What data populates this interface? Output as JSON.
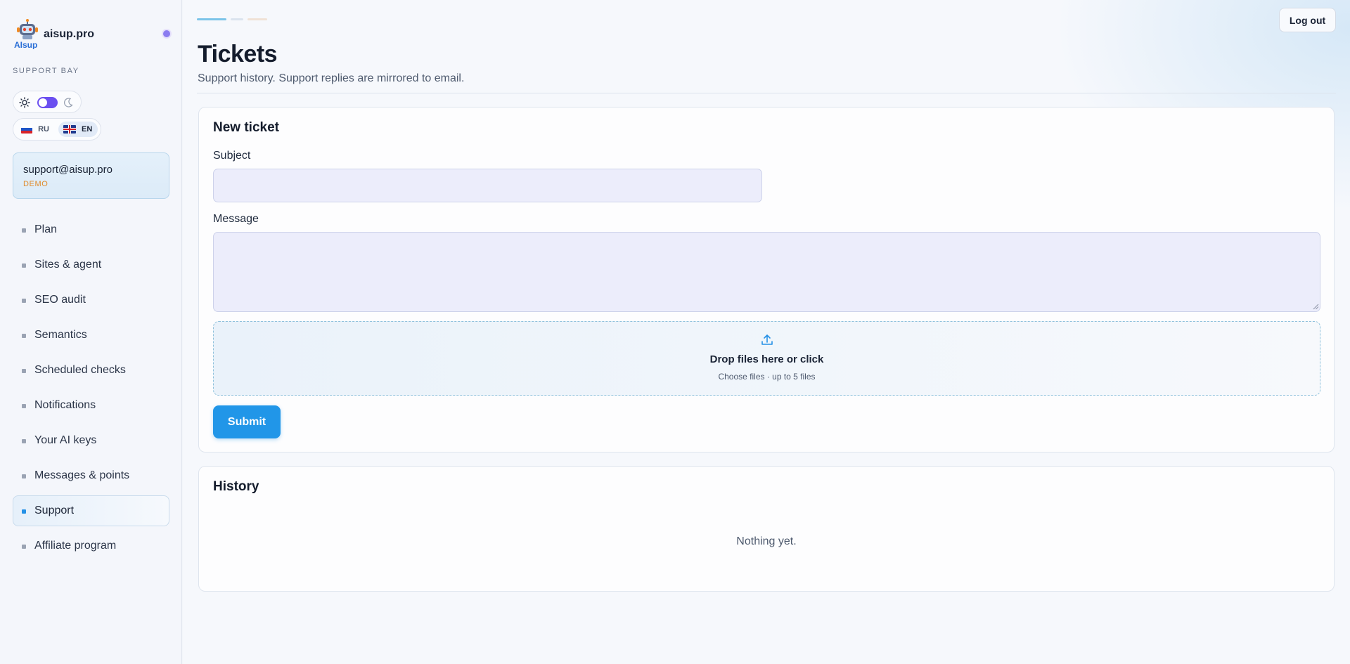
{
  "app": {
    "brand_name": "aisup.pro",
    "logo_text": "AIsup",
    "section_label": "SUPPORT BAY",
    "accent_color": "#2196e8",
    "theme_toggle_color": "#6b4ff0"
  },
  "language": {
    "options": [
      "RU",
      "EN"
    ],
    "selected": "EN"
  },
  "account": {
    "email": "support@aisup.pro",
    "badge": "DEMO"
  },
  "nav": {
    "items": [
      {
        "label": "Plan"
      },
      {
        "label": "Sites & agent"
      },
      {
        "label": "SEO audit"
      },
      {
        "label": "Semantics"
      },
      {
        "label": "Scheduled checks"
      },
      {
        "label": "Notifications"
      },
      {
        "label": "Your AI keys"
      },
      {
        "label": "Messages & points"
      },
      {
        "label": "Support",
        "active": true
      },
      {
        "label": "Affiliate program"
      }
    ]
  },
  "header": {
    "logout_label": "Log out",
    "title": "Tickets",
    "subtitle": "Support history. Support replies are mirrored to email."
  },
  "new_ticket": {
    "title": "New ticket",
    "subject_label": "Subject",
    "subject_value": "",
    "message_label": "Message",
    "message_value": "",
    "drop_title": "Drop files here or click",
    "drop_hint": "Choose files · up to 5 files",
    "submit_label": "Submit"
  },
  "history": {
    "title": "History",
    "empty_text": "Nothing yet."
  },
  "icons": [
    "logo-robot-icon",
    "status-dot-icon",
    "sun-icon",
    "moon-icon",
    "flag-ru-icon",
    "flag-en-icon",
    "upload-icon",
    "resize-grip-icon"
  ]
}
